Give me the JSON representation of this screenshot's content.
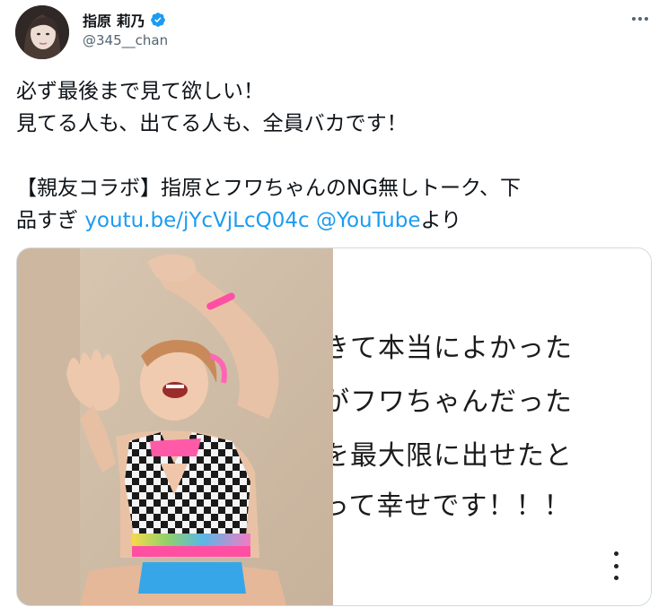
{
  "tweet": {
    "author": {
      "display_name": "指原 莉乃",
      "handle": "@345__chan",
      "verified": true
    },
    "text_lines": [
      "必ず最後まで見て欲しい！",
      "見てる人も、出てる人も、全員バカです！",
      "",
      "【親友コラボ】指原とフワちゃんのNG無しトーク、下"
    ],
    "last_line_prefix": "品すぎ ",
    "link": "youtu.be/jYcVjLcQ04c",
    "mention": "@YouTube",
    "last_line_suffix": "より"
  },
  "media_card": {
    "caption_lines": [
      "きて本当によかった",
      "がフワちゃんだった",
      "を最大限に出せたと",
      "って幸せです！！！"
    ]
  },
  "icons": [
    "verified-badge-icon",
    "more-options-icon",
    "card-more-icon"
  ],
  "colors": {
    "link": "#1d9bf0",
    "handle": "#536471",
    "verified": "#1d9bf0"
  }
}
